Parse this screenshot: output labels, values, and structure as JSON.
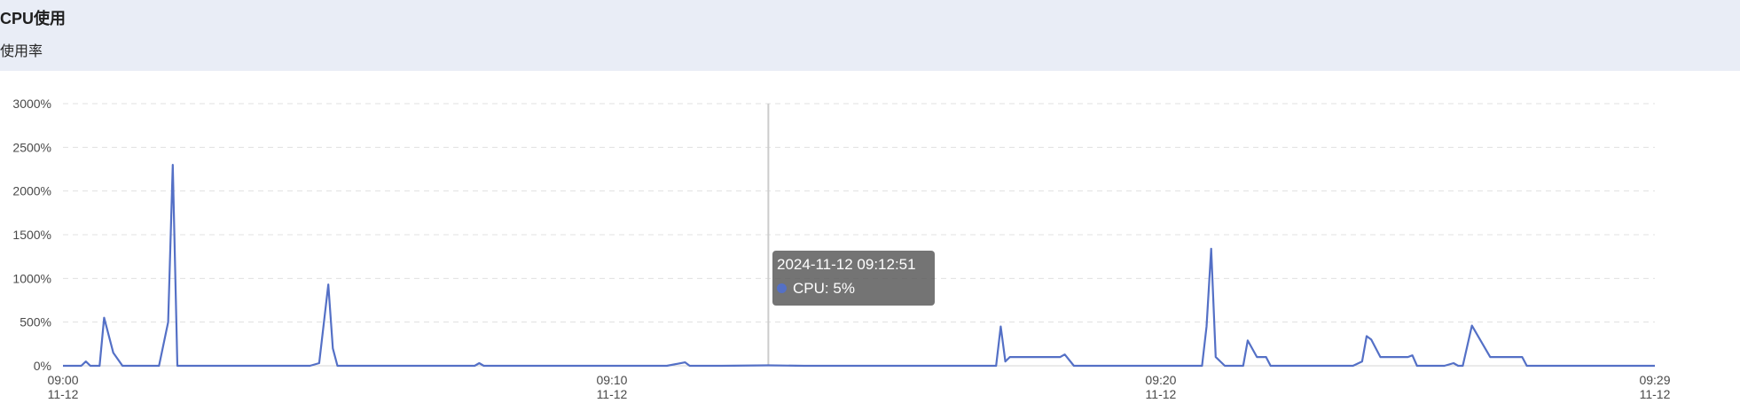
{
  "panel": {
    "title": "CPU使用",
    "subtitle": "使用率"
  },
  "tooltip": {
    "time": "2024-11-12 09:12:51",
    "series_label": "CPU",
    "value_text": "5%",
    "separator": ": "
  },
  "colors": {
    "series": "#5470c6",
    "grid": "#e0e0e0",
    "crosshair": "#cccccc",
    "header_bg": "#e9edf6"
  },
  "chart_data": {
    "type": "line",
    "title": "",
    "xlabel": "",
    "ylabel": "",
    "ylim": [
      0,
      3000
    ],
    "yticks": [
      "0%",
      "500%",
      "1000%",
      "1500%",
      "2000%",
      "2500%",
      "3000%"
    ],
    "ytick_values": [
      0,
      500,
      1000,
      1500,
      2000,
      2500,
      3000
    ],
    "xlim": [
      "09:00",
      "09:29"
    ],
    "xticks": [
      {
        "time": "09:00",
        "date": "11-12"
      },
      {
        "time": "09:10",
        "date": "11-12"
      },
      {
        "time": "09:20",
        "date": "11-12"
      },
      {
        "time": "09:29",
        "date": "11-12"
      }
    ],
    "grid": true,
    "crosshair_time": "09:12:51",
    "series": [
      {
        "name": "CPU",
        "x": [
          "09:00:00",
          "09:00:20",
          "09:00:25",
          "09:00:30",
          "09:00:35",
          "09:00:40",
          "09:00:45",
          "09:00:55",
          "09:01:05",
          "09:01:15",
          "09:01:30",
          "09:01:45",
          "09:01:55",
          "09:02:00",
          "09:02:05",
          "09:02:10",
          "09:02:30",
          "09:03:00",
          "09:03:30",
          "09:04:00",
          "09:04:30",
          "09:04:40",
          "09:04:50",
          "09:04:55",
          "09:05:00",
          "09:05:10",
          "09:05:30",
          "09:06:00",
          "09:07:00",
          "09:07:30",
          "09:07:35",
          "09:07:40",
          "09:08:00",
          "09:09:00",
          "09:10:00",
          "09:11:00",
          "09:11:20",
          "09:11:25",
          "09:11:30",
          "09:11:40",
          "09:12:00",
          "09:12:51",
          "09:13:30",
          "09:14:30",
          "09:15:30",
          "09:16:30",
          "09:17:00",
          "09:17:05",
          "09:17:10",
          "09:17:15",
          "09:17:25",
          "09:17:40",
          "09:18:00",
          "09:18:10",
          "09:18:15",
          "09:18:25",
          "09:19:00",
          "09:20:00",
          "09:20:45",
          "09:20:50",
          "09:20:55",
          "09:21:00",
          "09:21:10",
          "09:21:20",
          "09:21:30",
          "09:21:35",
          "09:21:45",
          "09:21:55",
          "09:22:00",
          "09:22:20",
          "09:23:00",
          "09:23:30",
          "09:23:40",
          "09:23:45",
          "09:23:50",
          "09:24:00",
          "09:24:10",
          "09:24:20",
          "09:24:30",
          "09:24:35",
          "09:24:40",
          "09:25:00",
          "09:25:10",
          "09:25:20",
          "09:25:25",
          "09:25:30",
          "09:25:40",
          "09:26:00",
          "09:26:20",
          "09:26:30",
          "09:26:35",
          "09:26:40",
          "09:27:00",
          "09:27:30",
          "09:28:00",
          "09:29:00"
        ],
        "y": [
          0,
          0,
          50,
          0,
          0,
          0,
          550,
          150,
          0,
          0,
          0,
          0,
          500,
          2300,
          0,
          0,
          0,
          0,
          0,
          0,
          0,
          30,
          930,
          200,
          0,
          0,
          0,
          0,
          0,
          0,
          30,
          0,
          0,
          0,
          0,
          0,
          40,
          0,
          0,
          0,
          0,
          5,
          0,
          0,
          0,
          0,
          0,
          450,
          50,
          100,
          100,
          100,
          100,
          100,
          130,
          0,
          0,
          0,
          0,
          450,
          1340,
          100,
          0,
          0,
          0,
          290,
          100,
          100,
          0,
          0,
          0,
          0,
          50,
          340,
          300,
          100,
          100,
          100,
          100,
          120,
          0,
          0,
          0,
          30,
          0,
          0,
          460,
          100,
          100,
          100,
          100,
          0,
          0,
          0,
          0,
          0
        ]
      }
    ]
  }
}
